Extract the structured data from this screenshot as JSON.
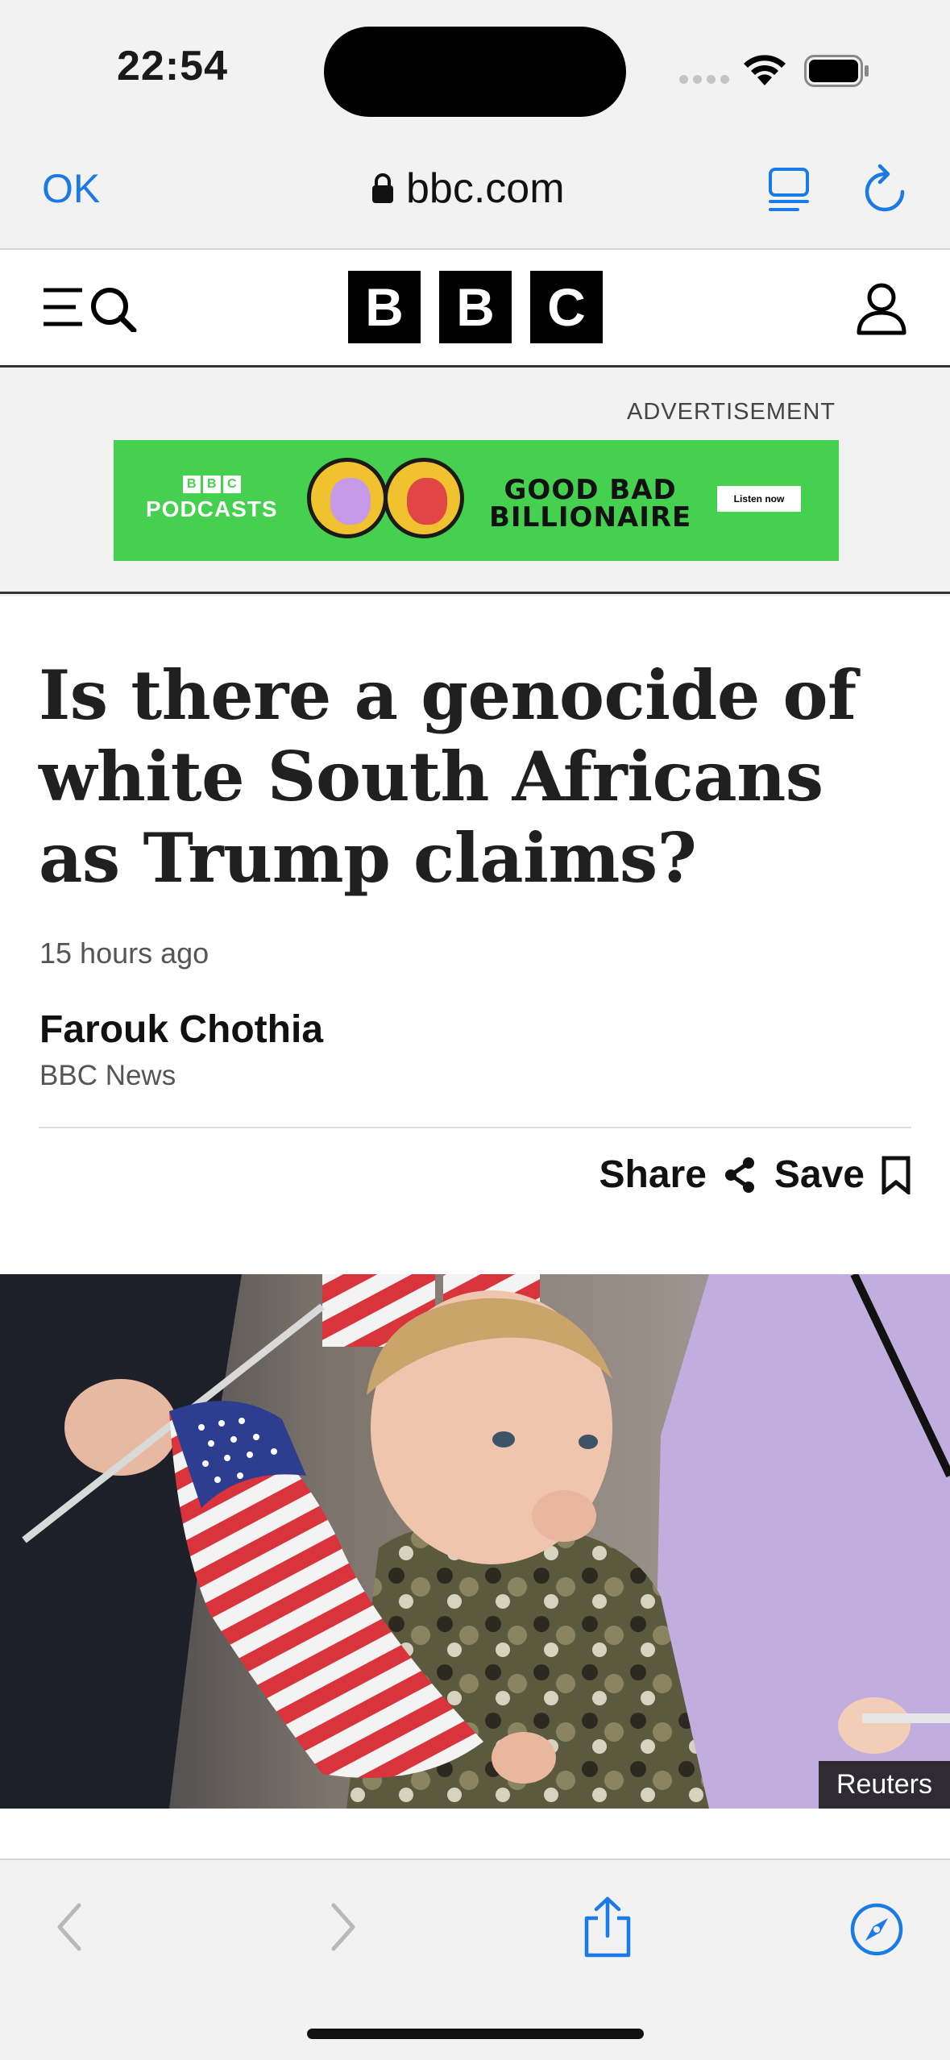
{
  "status_bar": {
    "time": "22:54"
  },
  "browser": {
    "done_label": "OK",
    "url": "bbc.com",
    "icons": [
      "lock-icon",
      "reader-icon",
      "reload-icon"
    ]
  },
  "bbc_header": {
    "logo_letters": [
      "B",
      "B",
      "C"
    ],
    "icons": [
      "menu-icon",
      "search-icon",
      "account-icon"
    ]
  },
  "ad": {
    "label": "ADVERTISEMENT",
    "brand_letters": [
      "B",
      "B",
      "C"
    ],
    "brand_sub": "PODCASTS",
    "title_line1": "GOOD BAD",
    "title_line2": "BILLIONAIRE",
    "cta": "Listen now",
    "colors": {
      "background": "#45d04f",
      "coin": "#f0c230"
    }
  },
  "article": {
    "headline": "Is there a genocide of white South Africans as Trump claims?",
    "timestamp": "15 hours ago",
    "author": "Farouk Chothia",
    "source": "BBC News",
    "share_label": "Share",
    "save_label": "Save",
    "photo_credit": "Reuters"
  },
  "toolbar": {
    "icons": [
      "back-icon",
      "forward-icon",
      "share-icon",
      "compass-icon"
    ],
    "accent": "#1a7ae6"
  }
}
